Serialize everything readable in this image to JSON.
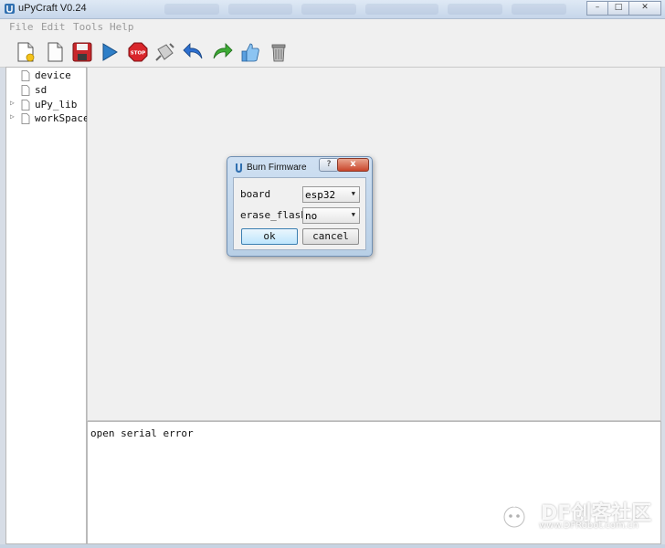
{
  "window": {
    "title": "uPyCraft V0.24",
    "controls": {
      "minimize": "–",
      "maximize": "□",
      "close": "✕"
    }
  },
  "menu": {
    "items": [
      "File",
      "Edit",
      "Tools",
      "Help"
    ]
  },
  "toolbar": {
    "tools": [
      "new-file-icon",
      "open-file-icon",
      "save-icon",
      "run-icon",
      "stop-icon",
      "connect-icon",
      "undo-icon",
      "redo-icon",
      "sync-icon",
      "clear-icon"
    ]
  },
  "sidebar": {
    "items": [
      {
        "label": "device",
        "expandable": false
      },
      {
        "label": "sd",
        "expandable": false
      },
      {
        "label": "uPy_lib",
        "expandable": true
      },
      {
        "label": "workSpace",
        "expandable": true
      }
    ]
  },
  "terminal": {
    "text": "open serial error"
  },
  "dialog": {
    "title": "Burn Firmware",
    "help_label": "?",
    "close_label": "x",
    "board_label": "board",
    "board_value": "esp32",
    "erase_label": "erase_flash",
    "erase_value": "no",
    "ok_label": "ok",
    "cancel_label": "cancel"
  },
  "watermark": {
    "brand": "DF创客社区",
    "url": "www.DFRobot.com.cn"
  },
  "colors": {
    "accent": "#3c7fb1",
    "close_red": "#c9452b",
    "stop_red": "#d9262b"
  }
}
